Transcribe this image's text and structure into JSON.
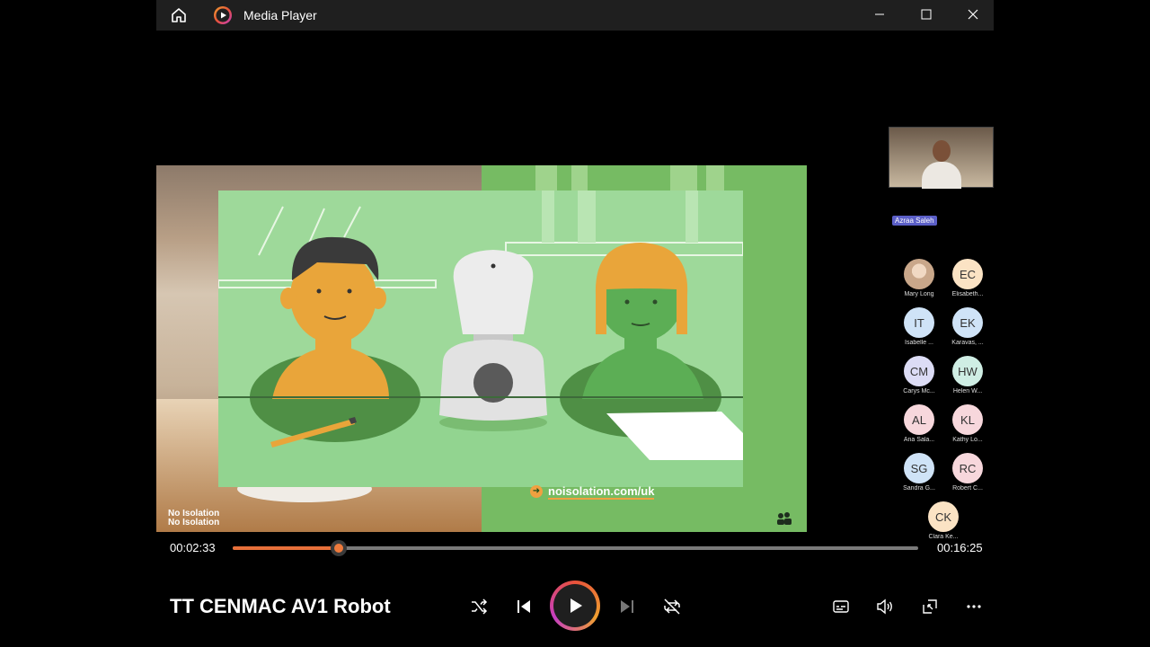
{
  "window": {
    "title": "Media Player"
  },
  "player": {
    "elapsed": "00:02:33",
    "duration": "00:16:25",
    "progress_fraction": 0.155,
    "media_title": "TT CENMAC AV1 Robot"
  },
  "video": {
    "brand_url": "noisolation.com/uk",
    "watermark_line1": "No Isolation",
    "watermark_line2": "No Isolation",
    "presenter_name": "Azraa Saleh"
  },
  "participants": [
    {
      "initials": "",
      "name": "Mary Long",
      "color": "#d9cbb8",
      "photo": true
    },
    {
      "initials": "EC",
      "name": "Elisabeth...",
      "color": "#fbe3c4"
    },
    {
      "initials": "IT",
      "name": "Isabelle ...",
      "color": "#cfe3f7"
    },
    {
      "initials": "EK",
      "name": "Karavas, ...",
      "color": "#cfe3f7"
    },
    {
      "initials": "CM",
      "name": "Carys Mc...",
      "color": "#dcdcf5"
    },
    {
      "initials": "HW",
      "name": "Helen W...",
      "color": "#cfeee4"
    },
    {
      "initials": "AL",
      "name": "Ana Sala...",
      "color": "#f7d7dc"
    },
    {
      "initials": "KL",
      "name": "Kathy Lo...",
      "color": "#f7d7dc"
    },
    {
      "initials": "SG",
      "name": "Sandra G...",
      "color": "#cfe3f7"
    },
    {
      "initials": "RC",
      "name": "Robert C...",
      "color": "#f7d7dc"
    },
    {
      "initials": "CK",
      "name": "Clara Ke...",
      "color": "#fbe3c4"
    }
  ]
}
